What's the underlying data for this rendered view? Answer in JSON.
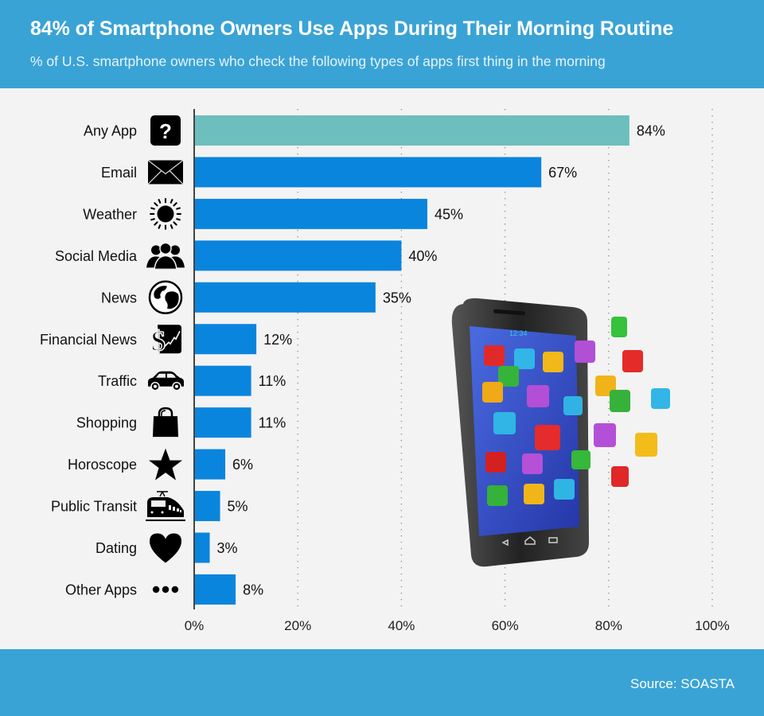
{
  "header": {
    "title": "84% of Smartphone Owners Use Apps During Their Morning Routine",
    "subtitle": "% of U.S. smartphone owners who check the following types of apps first thing in the morning"
  },
  "footer": {
    "source": "Source: SOASTA"
  },
  "colors": {
    "header_bg": "#3aa3d5",
    "highlight_bar": "#6cbfbc",
    "bar": "#0a85dd",
    "background": "#f3f3f3"
  },
  "chart_data": {
    "type": "bar",
    "orientation": "horizontal",
    "title": "84% of Smartphone Owners Use Apps During Their Morning Routine",
    "subtitle": "% of U.S. smartphone owners who check the following types of apps first thing in the morning",
    "xlabel": "",
    "ylabel": "",
    "xlim": [
      0,
      100
    ],
    "x_ticks": [
      "0%",
      "20%",
      "40%",
      "60%",
      "80%",
      "100%"
    ],
    "x_tick_values": [
      0,
      20,
      40,
      60,
      80,
      100
    ],
    "grid": "vertical dotted",
    "categories": [
      "Any App",
      "Email",
      "Weather",
      "Social Media",
      "News",
      "Financial News",
      "Traffic",
      "Shopping",
      "Horoscope",
      "Public Transit",
      "Dating",
      "Other Apps"
    ],
    "values": [
      84,
      67,
      45,
      40,
      35,
      12,
      11,
      11,
      6,
      5,
      3,
      8
    ],
    "value_labels": [
      "84%",
      "67%",
      "45%",
      "40%",
      "35%",
      "12%",
      "11%",
      "11%",
      "6%",
      "5%",
      "3%",
      "8%"
    ],
    "icons": [
      "question-icon",
      "envelope-icon",
      "sun-icon",
      "people-icon",
      "globe-icon",
      "dollar-chart-icon",
      "car-icon",
      "shopping-bag-icon",
      "star-icon",
      "train-icon",
      "heart-icon",
      "ellipsis-icon"
    ],
    "highlight_index": 0,
    "source": "Source: SOASTA"
  },
  "illustration": {
    "phone_clock": "12:34"
  }
}
